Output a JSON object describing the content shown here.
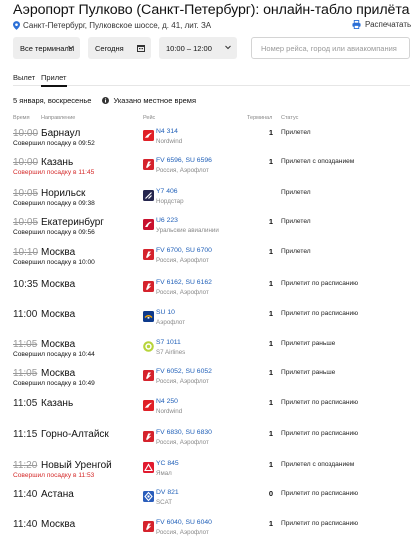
{
  "page": {
    "title": "Аэропорт Пулково (Санкт-Петербург): онлайн-табло прилёта",
    "address": "Санкт-Петербург, Пулковское шоссе, д. 41, лит. ЗА",
    "print_label": "Распечатать"
  },
  "filters": {
    "terminals": "Все терминалы",
    "day": "Сегодня",
    "time_range": "10:00 – 12:00",
    "search_placeholder": "Номер рейса, город или авиакомпания"
  },
  "tabs": {
    "departure": "Вылет",
    "arrival": "Прилет"
  },
  "date_line": {
    "date": "5 января, воскресенье",
    "note": "Указано местное время"
  },
  "columns": {
    "time": "Время",
    "direction": "Направление",
    "flight": "Рейс",
    "terminal": "Терминал",
    "status": "Статус"
  },
  "colors": {
    "link": "#1f5fb8",
    "delay_red": "#d42a2a",
    "rossiya_red": "#d5232d",
    "nordwind_red": "#e02027",
    "nordstar_navy": "#25254d",
    "ural_red": "#c8102e",
    "aeroflot_blue": "#0d3a8c",
    "s7_green": "#b7d43a",
    "yamal_red": "#e11a2f",
    "scat_blue": "#2a5dbb"
  },
  "flights": [
    {
      "time": "10:00",
      "crossed": true,
      "city": "Барнаул",
      "sub": "Совершил посадку в 09:52",
      "sub_red": false,
      "logo": "nordwind-logo",
      "flight": "N4 314",
      "airline": "Nordwind",
      "terminal": "1",
      "status": "Прилетел"
    },
    {
      "time": "10:00",
      "crossed": true,
      "city": "Казань",
      "sub": "Совершил посадку в 11:45",
      "sub_red": true,
      "logo": "rossiya-logo",
      "flight": "FV 6596, SU 6596",
      "airline": "Россия, Аэрофлот",
      "terminal": "1",
      "status": "Прилетел с опозданием"
    },
    {
      "time": "10:05",
      "crossed": true,
      "city": "Норильск",
      "sub": "Совершил посадку в 09:38",
      "sub_red": false,
      "logo": "nordstar-logo",
      "flight": "Y7 406",
      "airline": "Нордстар",
      "terminal": "",
      "status": "Прилетел"
    },
    {
      "time": "10:05",
      "crossed": true,
      "city": "Екатеринбург",
      "sub": "Совершил посадку в 09:56",
      "sub_red": false,
      "logo": "ural-logo",
      "flight": "U6 223",
      "airline": "Уральские авиалинии",
      "terminal": "1",
      "status": "Прилетел"
    },
    {
      "time": "10:10",
      "crossed": true,
      "city": "Москва",
      "sub": "Совершил посадку в 10:00",
      "sub_red": false,
      "logo": "rossiya-logo",
      "flight": "FV 6700, SU 6700",
      "airline": "Россия, Аэрофлот",
      "terminal": "1",
      "status": "Прилетел"
    },
    {
      "time": "10:35",
      "crossed": false,
      "city": "Москва",
      "sub": "",
      "sub_red": false,
      "logo": "rossiya-logo",
      "flight": "FV 6162, SU 6162",
      "airline": "Россия, Аэрофлот",
      "terminal": "1",
      "status": "Прилетит по расписанию"
    },
    {
      "time": "11:00",
      "crossed": false,
      "city": "Москва",
      "sub": "",
      "sub_red": false,
      "logo": "aeroflot-logo",
      "flight": "SU 10",
      "airline": "Аэрофлот",
      "terminal": "1",
      "status": "Прилетит по расписанию"
    },
    {
      "time": "11:05",
      "crossed": true,
      "city": "Москва",
      "sub": "Совершил посадку в 10:44",
      "sub_red": false,
      "logo": "s7-logo",
      "flight": "S7 1011",
      "airline": "S7 Airlines",
      "terminal": "1",
      "status": "Прилетит раньше"
    },
    {
      "time": "11:05",
      "crossed": true,
      "city": "Москва",
      "sub": "Совершил посадку в 10:49",
      "sub_red": false,
      "logo": "rossiya-logo",
      "flight": "FV 6052, SU 6052",
      "airline": "Россия, Аэрофлот",
      "terminal": "1",
      "status": "Прилетит раньше"
    },
    {
      "time": "11:05",
      "crossed": false,
      "city": "Казань",
      "sub": "",
      "sub_red": false,
      "logo": "nordwind-logo",
      "flight": "N4 250",
      "airline": "Nordwind",
      "terminal": "1",
      "status": "Прилетит по расписанию"
    },
    {
      "time": "11:15",
      "crossed": false,
      "city": "Горно-Алтайск",
      "sub": "",
      "sub_red": false,
      "logo": "rossiya-logo",
      "flight": "FV 6830, SU 6830",
      "airline": "Россия, Аэрофлот",
      "terminal": "1",
      "status": "Прилетит по расписанию"
    },
    {
      "time": "11:20",
      "crossed": true,
      "city": "Новый Уренгой",
      "sub": "Совершил посадку в 11:53",
      "sub_red": true,
      "logo": "yamal-logo",
      "flight": "YC 845",
      "airline": "Ямал",
      "terminal": "1",
      "status": "Прилетел с опозданием"
    },
    {
      "time": "11:40",
      "crossed": false,
      "city": "Астана",
      "sub": "",
      "sub_red": false,
      "logo": "scat-logo",
      "flight": "DV 821",
      "airline": "SCAT",
      "terminal": "0",
      "status": "Прилетит по расписанию"
    },
    {
      "time": "11:40",
      "crossed": false,
      "city": "Москва",
      "sub": "",
      "sub_red": false,
      "logo": "rossiya-logo",
      "flight": "FV 6040, SU 6040",
      "airline": "Россия, Аэрофлот",
      "terminal": "1",
      "status": "Прилетит по расписанию"
    }
  ]
}
